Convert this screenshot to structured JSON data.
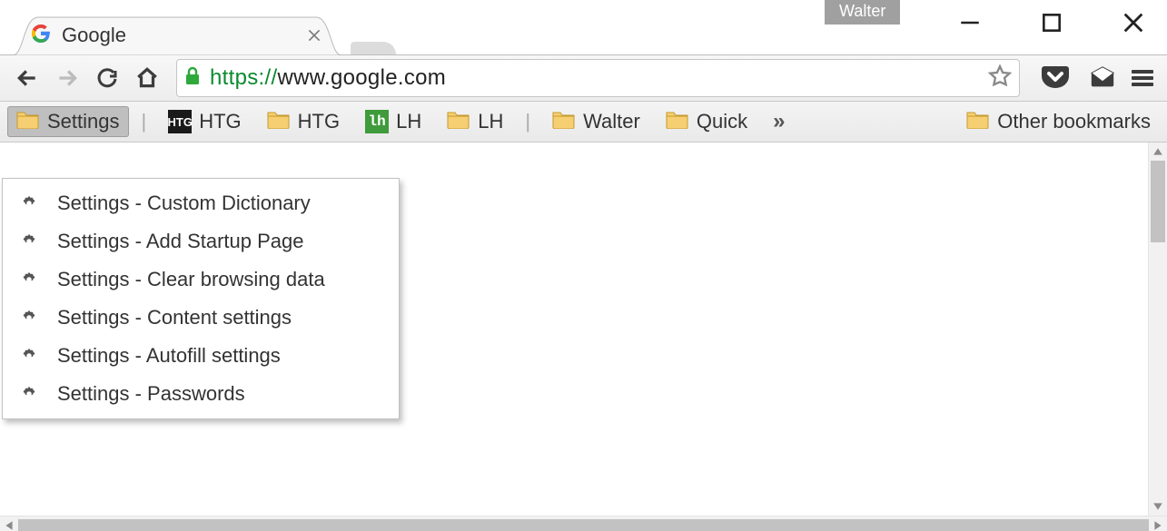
{
  "window": {
    "profile_name": "Walter"
  },
  "tab": {
    "title": "Google"
  },
  "omnibox": {
    "scheme": "https",
    "colon": "://",
    "host": "www.google.com"
  },
  "bookmarks_bar": {
    "active_folder": "Settings",
    "items": [
      {
        "label": "HTG",
        "icon": "htg"
      },
      {
        "label": "HTG",
        "icon": "folder"
      },
      {
        "label": "LH",
        "icon": "lh"
      },
      {
        "label": "LH",
        "icon": "folder"
      }
    ],
    "group2": [
      {
        "label": "Walter",
        "icon": "folder"
      },
      {
        "label": "Quick",
        "icon": "folder"
      }
    ],
    "overflow": "»",
    "other_label": "Other bookmarks"
  },
  "dropdown": {
    "items": [
      "Settings - Custom Dictionary",
      "Settings - Add Startup Page",
      "Settings - Clear browsing data",
      "Settings - Content settings",
      "Settings - Autofill settings",
      "Settings - Passwords"
    ]
  }
}
